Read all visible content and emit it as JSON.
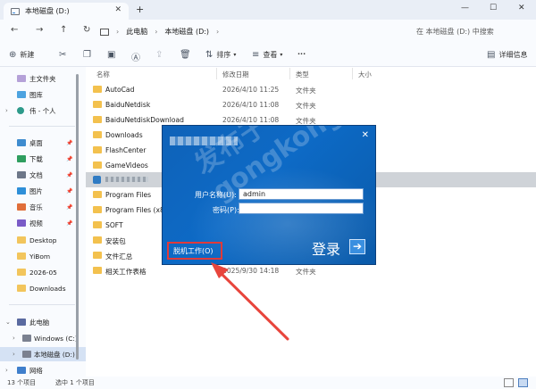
{
  "window": {
    "tab_title": "本地磁盘 (D:)",
    "tab_close": "✕",
    "new_tab": "+",
    "minimize": "—",
    "maximize": "☐",
    "close": "✕"
  },
  "nav": {
    "back": "←",
    "forward": "→",
    "up": "↑",
    "refresh": "↻",
    "breadcrumb": [
      "此电脑",
      "本地磁盘 (D:)"
    ],
    "breadcrumb_sep": "›",
    "search_placeholder": "在 本地磁盘 (D:) 中搜索"
  },
  "toolbar": {
    "new_label": "新建",
    "sort_label": "排序",
    "view_label": "查看",
    "more": "···",
    "details_label": "详细信息"
  },
  "sidebar": {
    "items": [
      {
        "label": "主文件夹",
        "icon": "home-icon"
      },
      {
        "label": "图库",
        "icon": "gallery-icon"
      },
      {
        "label": "伟 - 个人",
        "icon": "person-icon"
      },
      {
        "label": "桌面",
        "icon": "desktop-icon"
      },
      {
        "label": "下载",
        "icon": "download-icon"
      },
      {
        "label": "文档",
        "icon": "documents-icon"
      },
      {
        "label": "图片",
        "icon": "pictures-icon"
      },
      {
        "label": "音乐",
        "icon": "music-icon"
      },
      {
        "label": "视频",
        "icon": "video-icon"
      },
      {
        "label": "Desktop",
        "icon": "folder-icon"
      },
      {
        "label": "YiBom",
        "icon": "folder-icon"
      },
      {
        "label": "2026-05",
        "icon": "folder-icon"
      },
      {
        "label": "Downloads",
        "icon": "folder-icon"
      },
      {
        "label": "此电脑",
        "icon": "pc-icon"
      },
      {
        "label": "Windows (C:)",
        "icon": "drive-icon"
      },
      {
        "label": "本地磁盘 (D:)",
        "icon": "drive-icon"
      },
      {
        "label": "网络",
        "icon": "network-icon"
      }
    ]
  },
  "columns": {
    "name": "名称",
    "date": "修改日期",
    "type": "类型",
    "size": "大小"
  },
  "files": [
    {
      "name": "AutoCad",
      "date": "2026/4/10 11:25",
      "type": "文件夹"
    },
    {
      "name": "BaiduNetdisk",
      "date": "2026/4/10 11:08",
      "type": "文件夹"
    },
    {
      "name": "BaiduNetdiskDownload",
      "date": "2026/4/10 11:08",
      "type": "文件夹"
    },
    {
      "name": "Downloads",
      "date": "",
      "type": ""
    },
    {
      "name": "FlashCenter",
      "date": "",
      "type": ""
    },
    {
      "name": "GameVideos",
      "date": "",
      "type": ""
    },
    {
      "name": "",
      "date": "",
      "type": ""
    },
    {
      "name": "Program Files",
      "date": "",
      "type": ""
    },
    {
      "name": "Program Files (x86)",
      "date": "",
      "type": ""
    },
    {
      "name": "SOFT",
      "date": "",
      "type": ""
    },
    {
      "name": "安装包",
      "date": "",
      "type": ""
    },
    {
      "name": "文件汇总",
      "date": "",
      "type": ""
    },
    {
      "name": "相关工作表格",
      "date": "2025/9/30 14:18",
      "type": "文件夹"
    }
  ],
  "status": {
    "count": "13 个项目",
    "selected": "选中 1 个项目"
  },
  "dialog": {
    "close": "✕",
    "username_label": "用户名称(U):",
    "username_value": "admin",
    "password_label": "密码(P):",
    "password_value": "",
    "offline_label": "脱机工作(O)",
    "login_label": "登录",
    "login_arrow": "➔",
    "watermark": "gongkong ®",
    "watermark_cn": "发布于"
  },
  "colors": {
    "dialog_bg": "#0d6ac6",
    "highlight_border": "#e03a3a",
    "annotation_arrow": "#e8453c",
    "folder": "#f3c14e"
  }
}
